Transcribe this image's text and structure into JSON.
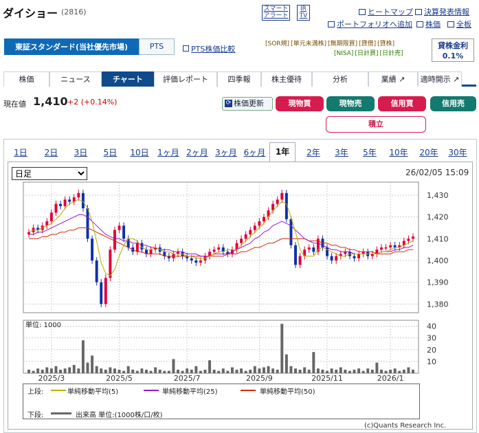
{
  "header": {
    "title": "ダイショー",
    "code": "(2816)",
    "smart_alert": "スマート\nアラート",
    "ir_tv": "IR\nTV"
  },
  "links": {
    "heatmap": "ヒートマップ",
    "earnings": "決算発表情報",
    "portfolio": "ポートフォリオへ追加",
    "stock_price": "株価",
    "all_boards": "全板",
    "pts_compare": "PTS株価比較"
  },
  "market": {
    "selected": "東証スタンダード(当社優先市場)",
    "pts": "PTS"
  },
  "tags": {
    "line1": [
      "[SOR規]",
      "[単元未満株]",
      "[無期限買]",
      "[貸借]",
      "[貸株]"
    ],
    "line2": [
      "[NISA]",
      "[日計買]",
      "[日計売]"
    ]
  },
  "rate": {
    "label": "貸株金利",
    "value": "0.1%"
  },
  "tabs": [
    "株価",
    "ニュース",
    "チャート",
    "評価レポート",
    "四季報",
    "株主優待",
    "分析",
    "業績",
    "適時開示"
  ],
  "active_tab": "チャート",
  "quote": {
    "label": "現在値",
    "price": "1,410",
    "change": "+2 (+0.14%)"
  },
  "buttons": {
    "update": "株価更新",
    "spot_buy": "現物買",
    "spot_sell": "現物売",
    "margin_buy": "信用買",
    "margin_sell": "信用売",
    "tsumitate": "積立"
  },
  "periods": [
    "1日",
    "2日",
    "3日",
    "5日",
    "10日",
    "1ヶ月",
    "2ヶ月",
    "3ヶ月",
    "6ヶ月",
    "1年",
    "2年",
    "3年",
    "5年",
    "10年",
    "20年",
    "30年"
  ],
  "active_period": "1年",
  "chart_select": {
    "selected": "日足"
  },
  "timestamp": "26/02/05 15:09",
  "volume_unit": "単位: 1000",
  "legend": {
    "upper_label": "上段:",
    "ma5": "単純移動平均(5)",
    "ma25": "単純移動平均(25)",
    "ma50": "単純移動平均(50)",
    "lower_label": "下段:",
    "vol": "出来高 単位:(1000株/口/枚)"
  },
  "colors": {
    "ma5": "#b5b000",
    "ma25": "#9a16c8",
    "ma50": "#d42a0a",
    "up": "#e0003a",
    "down": "#1030a8",
    "volume": "#666666"
  },
  "copyright": "(c)Quants Research Inc.",
  "chart_data": {
    "type": "candlestick",
    "x_ticks": [
      "2025/3",
      "2025/5",
      "2025/7",
      "2025/9",
      "2025/11",
      "2026/1"
    ],
    "price_ticks": [
      "1,430",
      "1,420",
      "1,410",
      "1,400",
      "1,390",
      "1,380"
    ],
    "ylim": [
      1376,
      1436
    ],
    "volume_ticks": [
      "40",
      "30",
      "20",
      "10"
    ],
    "volume_ylim": [
      0,
      45
    ],
    "close": [
      1413,
      1415,
      1414,
      1416,
      1418,
      1422,
      1426,
      1425,
      1428,
      1427,
      1429,
      1431,
      1424,
      1410,
      1400,
      1390,
      1380,
      1392,
      1405,
      1414,
      1416,
      1410,
      1406,
      1404,
      1408,
      1405,
      1403,
      1405,
      1406,
      1404,
      1402,
      1401,
      1403,
      1404,
      1402,
      1401,
      1400,
      1399,
      1400,
      1402,
      1404,
      1405,
      1406,
      1404,
      1403,
      1405,
      1408,
      1410,
      1412,
      1414,
      1416,
      1418,
      1420,
      1423,
      1426,
      1428,
      1431,
      1419,
      1407,
      1398,
      1402,
      1405,
      1406,
      1404,
      1410,
      1406,
      1402,
      1400,
      1402,
      1403,
      1404,
      1402,
      1401,
      1403,
      1404,
      1402,
      1403,
      1405,
      1406,
      1406,
      1407,
      1406,
      1407,
      1409,
      1410,
      1411
    ],
    "ma5": [
      1413,
      1414,
      1414,
      1415,
      1416,
      1417,
      1419,
      1421,
      1424,
      1426,
      1427,
      1428,
      1427,
      1424,
      1418,
      1409,
      1399,
      1394,
      1393,
      1396,
      1402,
      1407,
      1410,
      1410,
      1409,
      1406,
      1405,
      1405,
      1406,
      1405,
      1404,
      1404,
      1403,
      1403,
      1403,
      1402,
      1402,
      1401,
      1401,
      1401,
      1402,
      1403,
      1404,
      1404,
      1405,
      1405,
      1405,
      1407,
      1409,
      1411,
      1413,
      1415,
      1417,
      1420,
      1423,
      1425,
      1427,
      1426,
      1420,
      1413,
      1405,
      1402,
      1402,
      1402,
      1405,
      1406,
      1405,
      1404,
      1403,
      1402,
      1402,
      1403,
      1403,
      1403,
      1403,
      1403,
      1403,
      1403,
      1404,
      1404,
      1405,
      1406,
      1406,
      1407,
      1408,
      1409
    ],
    "ma25": [
      1412,
      1412,
      1413,
      1413,
      1414,
      1415,
      1416,
      1417,
      1418,
      1419,
      1420,
      1421,
      1421,
      1420,
      1418,
      1416,
      1414,
      1412,
      1411,
      1410,
      1410,
      1409,
      1409,
      1408,
      1408,
      1407,
      1407,
      1406,
      1406,
      1405,
      1405,
      1405,
      1404,
      1404,
      1404,
      1403,
      1403,
      1403,
      1402,
      1402,
      1402,
      1403,
      1403,
      1403,
      1403,
      1404,
      1405,
      1406,
      1407,
      1408,
      1410,
      1411,
      1413,
      1414,
      1416,
      1417,
      1418,
      1417,
      1416,
      1414,
      1412,
      1410,
      1409,
      1408,
      1408,
      1407,
      1406,
      1405,
      1405,
      1404,
      1404,
      1404,
      1403,
      1403,
      1403,
      1403,
      1403,
      1403,
      1404,
      1404,
      1404,
      1405,
      1405,
      1406,
      1406,
      1407
    ],
    "ma50": [
      1410,
      1410,
      1410,
      1411,
      1411,
      1412,
      1412,
      1413,
      1413,
      1414,
      1414,
      1415,
      1415,
      1415,
      1414,
      1413,
      1412,
      1411,
      1410,
      1409,
      1408,
      1407,
      1406,
      1405,
      1404,
      1404,
      1403,
      1403,
      1403,
      1403,
      1402,
      1402,
      1402,
      1402,
      1402,
      1402,
      1402,
      1402,
      1402,
      1402,
      1402,
      1402,
      1402,
      1402,
      1403,
      1403,
      1403,
      1404,
      1404,
      1405,
      1406,
      1406,
      1407,
      1408,
      1408,
      1409,
      1410,
      1410,
      1410,
      1410,
      1410,
      1410,
      1409,
      1409,
      1409,
      1408,
      1408,
      1407,
      1407,
      1406,
      1406,
      1405,
      1405,
      1404,
      1404,
      1404,
      1404,
      1403,
      1403,
      1403,
      1403,
      1404,
      1404,
      1404,
      1405,
      1405
    ],
    "volume": [
      3,
      2,
      4,
      3,
      5,
      4,
      6,
      3,
      4,
      5,
      7,
      4,
      28,
      9,
      15,
      6,
      4,
      3,
      5,
      4,
      3,
      2,
      6,
      3,
      2,
      4,
      3,
      2,
      5,
      3,
      2,
      2,
      12,
      3,
      2,
      4,
      3,
      6,
      2,
      3,
      11,
      3,
      2,
      4,
      2,
      5,
      3,
      4,
      2,
      3,
      6,
      4,
      5,
      6,
      4,
      3,
      42,
      16,
      6,
      4,
      3,
      5,
      3,
      18,
      4,
      3,
      2,
      4,
      3,
      5,
      3,
      2,
      3,
      4,
      2,
      4,
      3,
      9,
      3,
      2,
      3,
      4,
      2,
      3,
      5,
      3
    ]
  }
}
